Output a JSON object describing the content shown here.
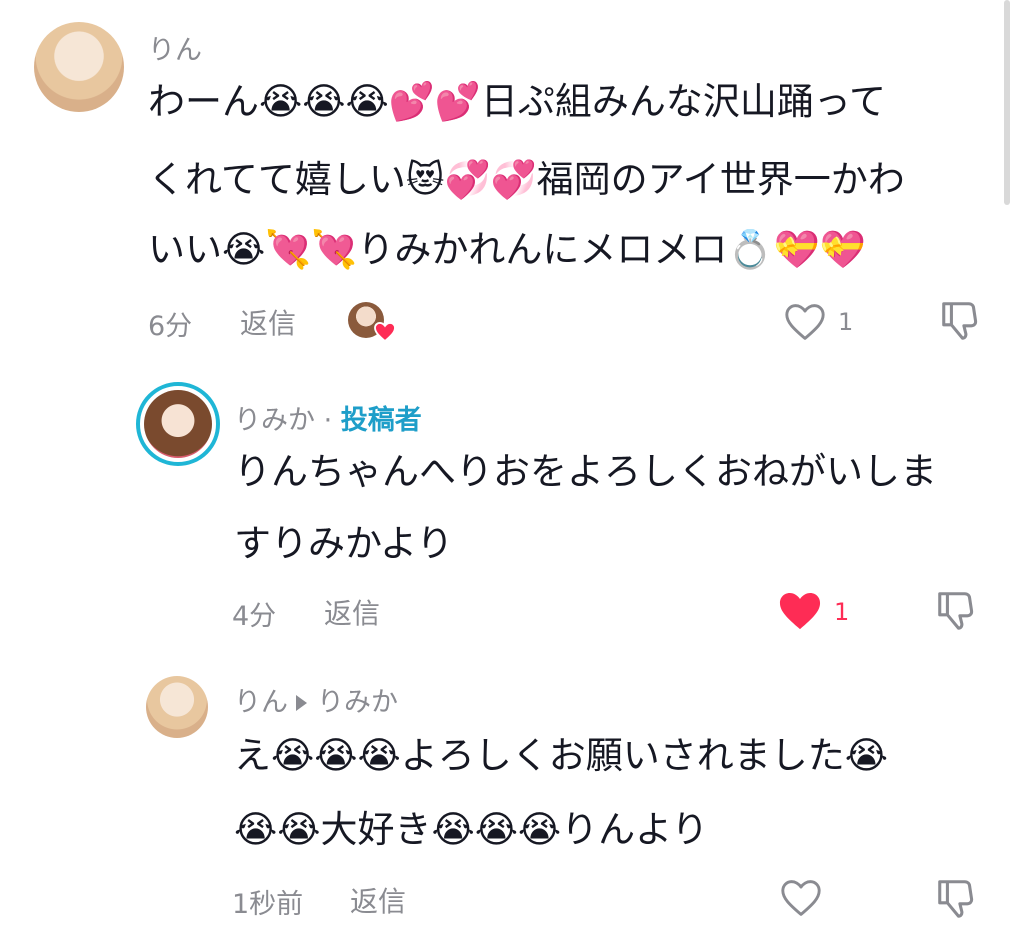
{
  "comments": [
    {
      "username": "りん",
      "lines": [
        "わーん😭😭😭💕💕日ぷ組みんな沢山踊って",
        "くれてて嬉しい😻💞💞福岡のアイ世界一かわ",
        "いい😭💘💘りみかれんにメロメロ💍💝💝"
      ],
      "time": "6分",
      "reply_label": "返信",
      "like_count": "1"
    },
    {
      "username": "りみか",
      "separator": "·",
      "author_badge": "投稿者",
      "lines": [
        "りんちゃんへりおをよろしくおねがいしま",
        "すりみかより"
      ],
      "time": "4分",
      "reply_label": "返信",
      "like_count": "1",
      "liked_color": "#fe2c55"
    },
    {
      "username": "りん",
      "reply_to": "りみか",
      "lines": [
        "え😭😭😭よろしくお願いされました😭",
        "😭😭大好き😭😭😭りんより"
      ],
      "time": "1秒前",
      "reply_label": "返信"
    }
  ]
}
